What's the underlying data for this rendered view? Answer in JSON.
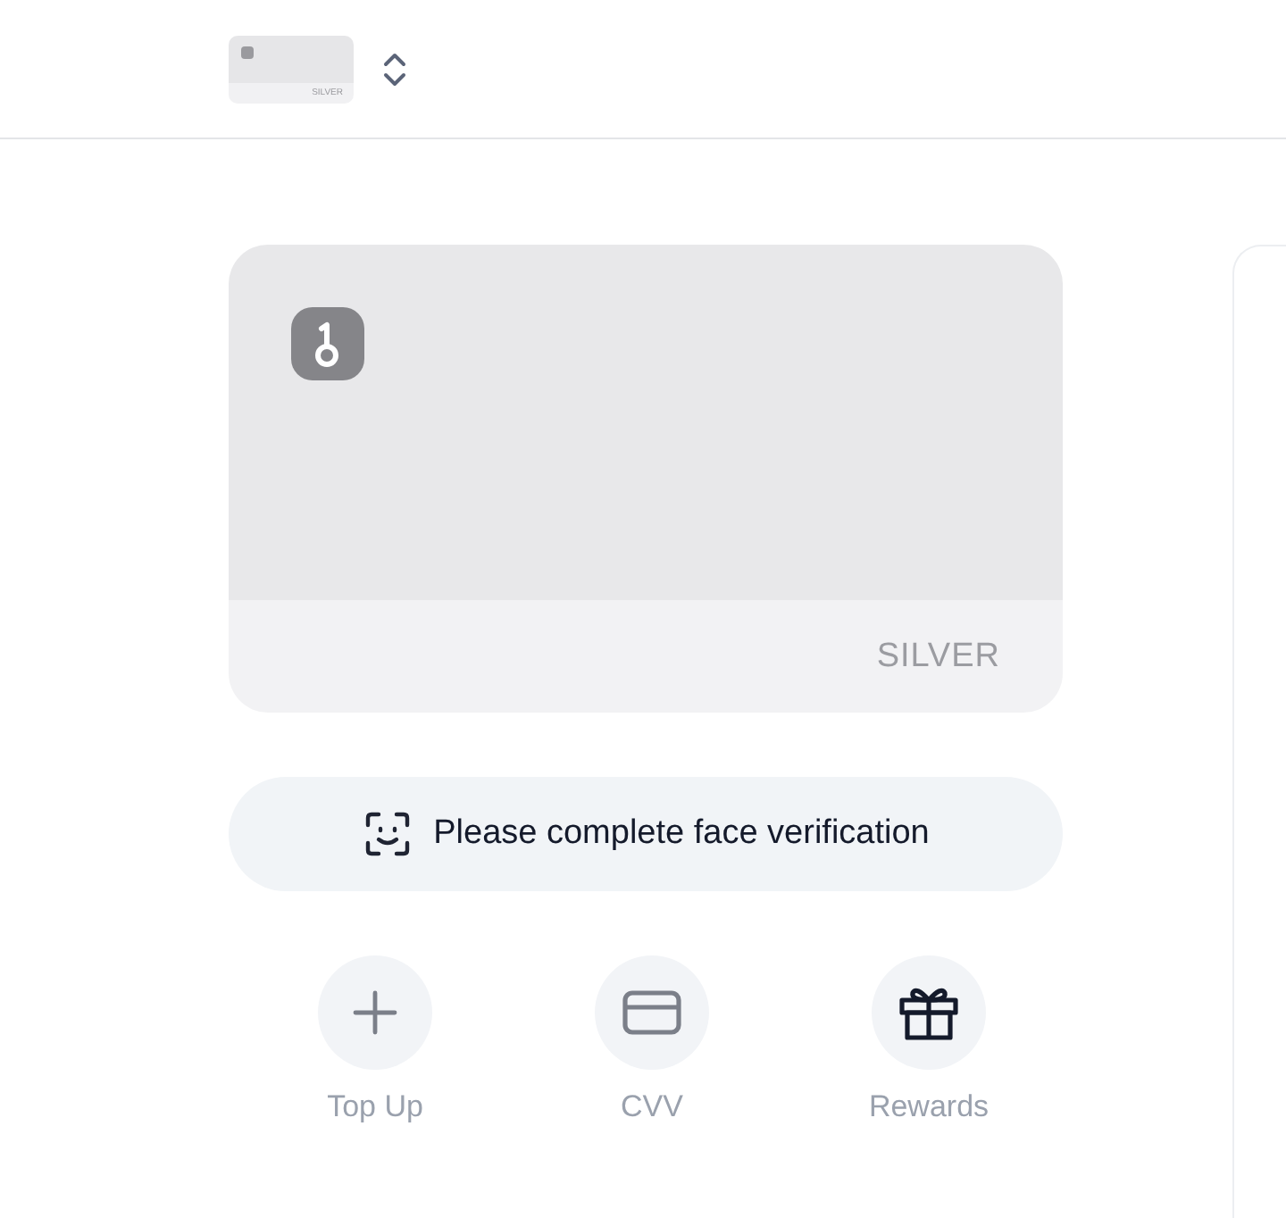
{
  "card_switcher": {
    "thumbnail_label": "SILVER"
  },
  "card": {
    "tier": "SILVER"
  },
  "verification": {
    "message": "Please complete face verification"
  },
  "actions": [
    {
      "kind": "plus",
      "label": "Top Up",
      "disabled": true
    },
    {
      "kind": "card",
      "label": "CVV",
      "disabled": true
    },
    {
      "kind": "gift",
      "label": "Rewards",
      "disabled": false
    }
  ]
}
